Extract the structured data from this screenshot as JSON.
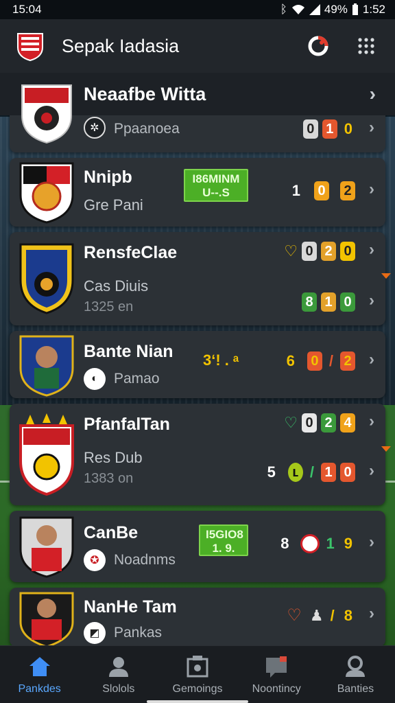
{
  "status": {
    "time": "15:04",
    "battery": "49%",
    "clock": "1:52"
  },
  "app": {
    "title": "Sepak Iadasia"
  },
  "featured": {
    "title": "Neaafbe Witta"
  },
  "cards": [
    {
      "sub": "Ppaanoea",
      "scores": [
        "0",
        "1",
        "0"
      ]
    },
    {
      "title": "Nnipb",
      "sub": "Gre Pani",
      "promo": "I86MINM\nU--.S",
      "scores": [
        "1",
        "0",
        "2"
      ]
    },
    {
      "title": "RensfeClae",
      "sub": "Cas Diuis",
      "small": "1325 en",
      "scores": [
        "0",
        "2",
        "0"
      ],
      "scores2": [
        "8",
        "1",
        "0"
      ]
    },
    {
      "title": "Bante Nian",
      "sub": "Pamao",
      "mid": "3ʻ! . ᵃ",
      "scores": [
        "6",
        "0",
        "/",
        "2"
      ]
    },
    {
      "title": "PfanfalTan",
      "sub": "Res Dub",
      "small": "1383 on",
      "scores": [
        "0",
        "2",
        "4"
      ],
      "scores2": [
        "5",
        "ʟ",
        "/",
        "1",
        "0"
      ]
    },
    {
      "title": "CanBe",
      "sub": "Noadnms",
      "promo": "I5GIO8\n1. 9.",
      "scores": [
        "8",
        "",
        "1",
        "9"
      ]
    },
    {
      "title": "NanHe Tam",
      "sub": "Pankas",
      "scores": [
        "",
        "",
        "/",
        "8"
      ]
    }
  ],
  "nav": [
    {
      "label": "Pankdes"
    },
    {
      "label": "Slolols"
    },
    {
      "label": "Gemoings"
    },
    {
      "label": "Noontincy"
    },
    {
      "label": "Banties"
    }
  ]
}
